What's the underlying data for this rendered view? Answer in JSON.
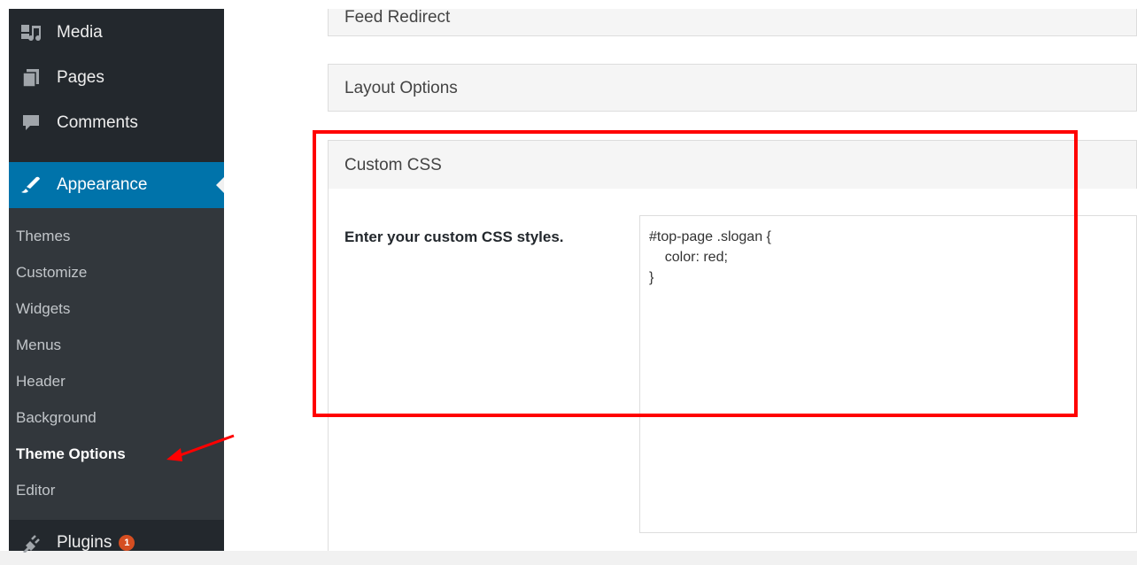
{
  "sidebar": {
    "items": [
      {
        "label": "Media",
        "icon": "media-icon"
      },
      {
        "label": "Pages",
        "icon": "pages-icon"
      },
      {
        "label": "Comments",
        "icon": "comments-icon"
      }
    ],
    "appearance": {
      "label": "Appearance",
      "icon": "paintbrush-icon"
    },
    "submenu": [
      "Themes",
      "Customize",
      "Widgets",
      "Menus",
      "Header",
      "Background",
      "Theme Options",
      "Editor"
    ],
    "current_submenu": "Theme Options",
    "plugins": {
      "label": "Plugins",
      "icon": "plugins-icon",
      "badge": "1"
    }
  },
  "main": {
    "panels": [
      {
        "title": "Feed Redirect"
      },
      {
        "title": "Layout Options"
      },
      {
        "title": "Custom CSS"
      }
    ],
    "custom_css": {
      "label": "Enter your custom CSS styles.",
      "value": "#top-page .slogan {\n    color: red;\n}"
    }
  },
  "colors": {
    "sidebar": "#23282d",
    "submenu": "#32373c",
    "accent": "#0073aa",
    "annotation": "#ff0000"
  }
}
